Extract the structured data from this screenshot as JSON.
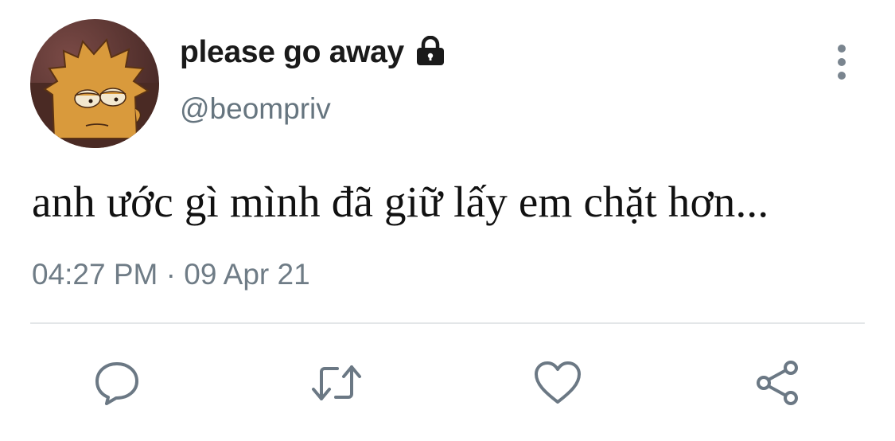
{
  "tweet": {
    "display_name": "please go away",
    "handle": "@beompriv",
    "text": "anh ước gì mình đã giữ lấy em chặt hơn...",
    "timestamp": "04:27 PM · 09 Apr 21"
  },
  "icons": {
    "lock": "lock-icon",
    "more": "more-vertical-icon",
    "reply": "reply-icon",
    "retweet": "retweet-icon",
    "like": "heart-icon",
    "share": "share-icon"
  },
  "colors": {
    "text": "#1a1a1a",
    "secondary": "#66757f",
    "icon": "#6b7884",
    "divider": "#e3e6e8",
    "background": "#ffffff"
  }
}
